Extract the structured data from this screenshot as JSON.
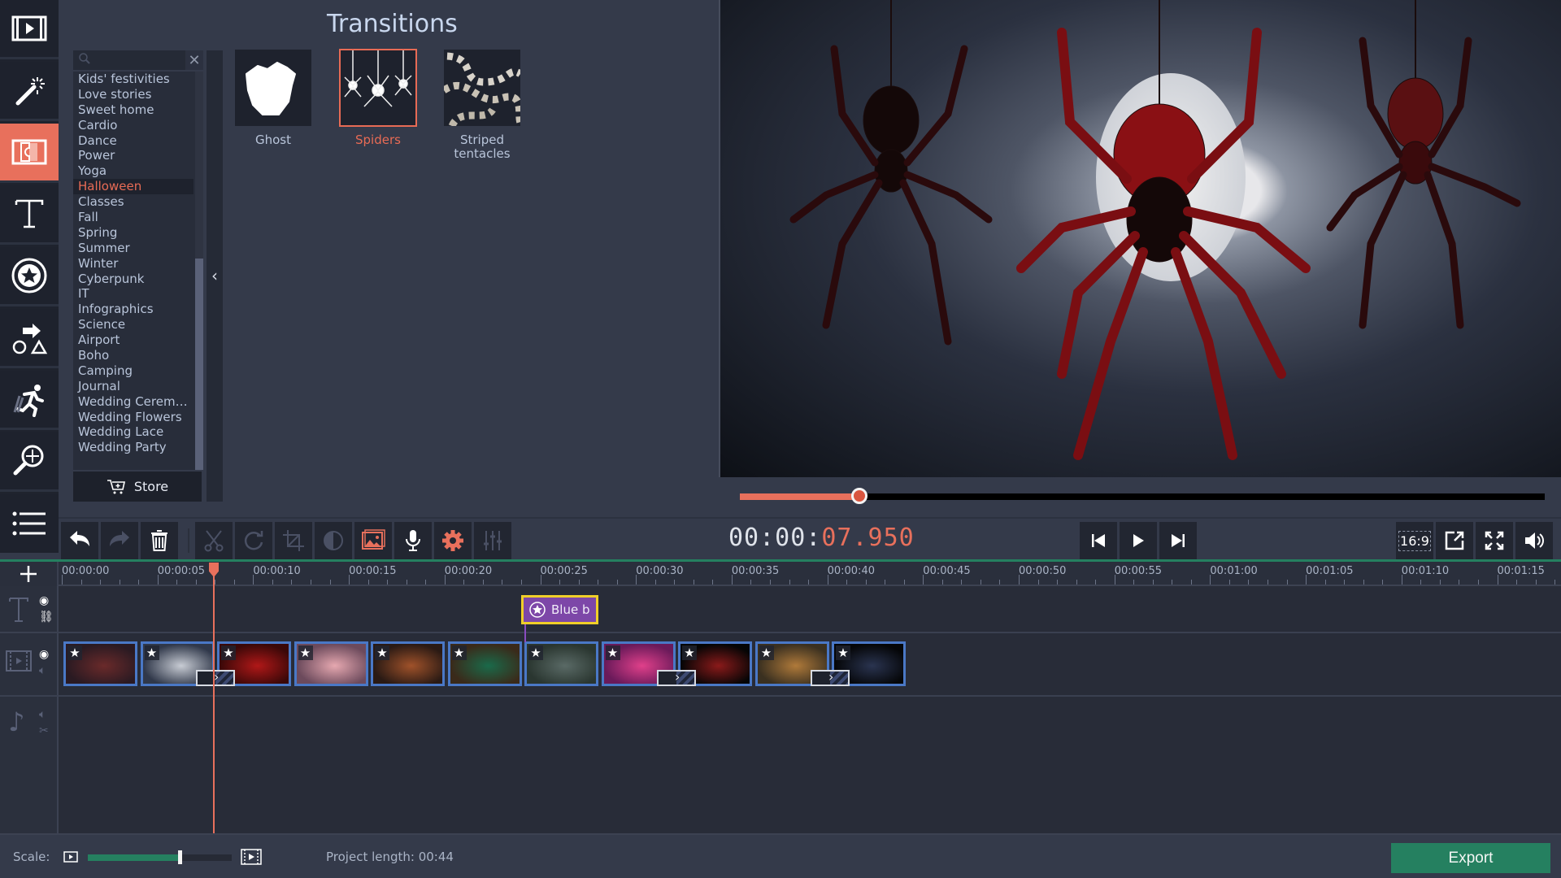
{
  "sidebar": {
    "items": [
      {
        "name": "import",
        "icon": "film-play-icon",
        "active": false
      },
      {
        "name": "filters",
        "icon": "magic-wand-icon",
        "active": false
      },
      {
        "name": "transitions",
        "icon": "transition-film-icon",
        "active": true
      },
      {
        "name": "titles",
        "icon": "text-t-icon",
        "active": false
      },
      {
        "name": "stickers",
        "icon": "sticker-star-icon",
        "active": false
      },
      {
        "name": "callouts",
        "icon": "shapes-arrow-icon",
        "active": false
      },
      {
        "name": "animation",
        "icon": "running-man-icon",
        "active": false
      },
      {
        "name": "pan-zoom",
        "icon": "zoom-move-icon",
        "active": false
      },
      {
        "name": "more",
        "icon": "list-icon",
        "active": false
      }
    ]
  },
  "panel": {
    "title": "Transitions",
    "search_placeholder": "",
    "categories": [
      "Kids' festivities",
      "Love stories",
      "Sweet home",
      "Cardio",
      "Dance",
      "Power",
      "Yoga",
      "Halloween",
      "Classes",
      "Fall",
      "Spring",
      "Summer",
      "Winter",
      "Cyberpunk",
      "IT",
      "Infographics",
      "Science",
      "Airport",
      "Boho",
      "Camping",
      "Journal",
      "Wedding Ceremo...",
      "Wedding Flowers",
      "Wedding Lace",
      "Wedding Party"
    ],
    "selected_category": "Halloween",
    "store_label": "Store",
    "transitions": [
      {
        "label": "Ghost",
        "selected": false
      },
      {
        "label": "Spiders",
        "selected": true
      },
      {
        "label": "Striped\ntentacles",
        "selected": false
      }
    ]
  },
  "player": {
    "progress": 0.148,
    "timecode_main": "00:00:",
    "timecode_frac": "07.950",
    "aspect_label": "16:9"
  },
  "toolbar": {
    "buttons": [
      "undo",
      "redo",
      "delete",
      "cut",
      "rotate",
      "crop",
      "color-adjust",
      "highlight-insert",
      "record-audio",
      "settings",
      "equalizer"
    ]
  },
  "timeline": {
    "ticks": [
      "00:00:00",
      "00:00:05",
      "00:00:10",
      "00:00:15",
      "00:00:20",
      "00:00:25",
      "00:00:30",
      "00:00:35",
      "00:00:40",
      "00:00:45",
      "00:00:50",
      "00:00:55",
      "00:01:00",
      "00:01:05",
      "00:01:10",
      "00:01:15"
    ],
    "playhead_time": "00:00:07.950",
    "title_clip_label": "Blue b",
    "clips": [
      {
        "colors": [
          "#2a1a22",
          "#6a2a2a"
        ]
      },
      {
        "colors": [
          "#30384a",
          "#c8ccd4"
        ]
      },
      {
        "colors": [
          "#3a0808",
          "#b01818"
        ]
      },
      {
        "colors": [
          "#6c4a5c",
          "#e6a8b0"
        ]
      },
      {
        "colors": [
          "#2a1a14",
          "#a0522a"
        ]
      },
      {
        "colors": [
          "#3a2a1a",
          "#1a6a4a"
        ]
      },
      {
        "colors": [
          "#2a3630",
          "#5a6a66"
        ]
      },
      {
        "colors": [
          "#6a1a5a",
          "#e0408a"
        ]
      },
      {
        "colors": [
          "#050505",
          "#8a1a1a"
        ]
      },
      {
        "colors": [
          "#3a3020",
          "#b07a3a"
        ]
      },
      {
        "colors": [
          "#050608",
          "#2a3450"
        ]
      }
    ]
  },
  "bottom": {
    "scale_label": "Scale:",
    "scale_value": 0.64,
    "project_length": "Project length:  00:44",
    "export_label": "Export"
  },
  "colors": {
    "accent": "#e8705c",
    "green": "#258060",
    "clip_border": "#4a78c6",
    "title_clip": "#7d47a8"
  }
}
